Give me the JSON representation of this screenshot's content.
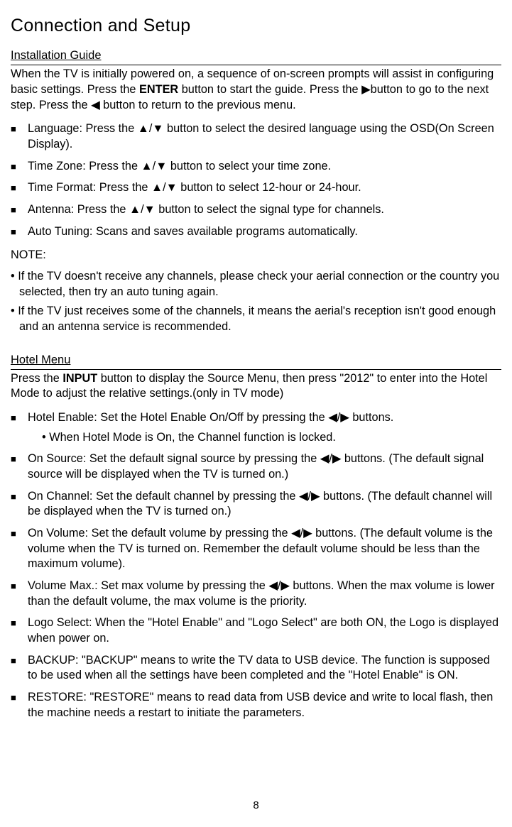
{
  "page": {
    "title": "Connection and Setup",
    "pageNumber": "8"
  },
  "section1": {
    "heading": "Installation Guide",
    "intro_p1": "When the TV is initially powered on, a sequence of on-screen prompts will assist in configuring basic settings. Press the ",
    "intro_enter": "ENTER",
    "intro_p2": " button to start the guide. Press the ▶button to go to the next step. Press the ◀ button to return to the previous menu.",
    "items": {
      "language": "Language: Press the ▲/▼ button to select the desired language using the OSD(On Screen Display).",
      "timezone": "Time Zone: Press the ▲/▼ button to select your time zone.",
      "timeformat": "Time Format: Press the ▲/▼ button to select 12-hour or 24-hour.",
      "antenna": "Antenna: Press the ▲/▼ button to select the signal type for channels.",
      "autotuning": "Auto Tuning: Scans and saves available programs automatically."
    },
    "noteLabel": "NOTE:",
    "note1": "• If the TV doesn't receive any channels, please check your aerial connection or the country you selected, then try an auto tuning again.",
    "note2": "• If the TV just receives some of the channels, it means the aerial's reception isn't good enough and an antenna service is recommended."
  },
  "section2": {
    "heading": "Hotel Menu",
    "intro_p1": "Press the ",
    "intro_input": " INPUT ",
    "intro_p2": " button to display the Source Menu, then press \"2012\" to enter into the Hotel Mode to adjust the relative settings.(only in TV mode)",
    "items": {
      "hotelEnable": "Hotel Enable: Set the Hotel Enable On/Off by pressing the ◀/▶  buttons.",
      "hotelEnableSub": "• When Hotel Mode is On, the Channel function is locked.",
      "onSource": "On Source: Set the default signal source by pressing the ◀/▶ buttons. (The default signal source will be displayed when the TV is turned on.)",
      "onChannel": "On Channel: Set the default channel by pressing the  ◀/▶  buttons. (The default channel will be displayed when the TV is turned on.)",
      "onVolume": "On Volume: Set the default volume by pressing the ◀/▶  buttons. (The default volume is the volume when the TV is turned on. Remember the default volume should be less than the maximum volume).",
      "volumeMax": "Volume Max.: Set max volume by pressing the ◀/▶  buttons. When the max volume is lower than the default volume, the max volume is the priority.",
      "logoSelect": "Logo Select: When the \"Hotel Enable\" and \"Logo Select\" are both ON, the Logo is displayed when power on.",
      "backup": "BACKUP: \"BACKUP\" means to write the TV data to USB device. The function is supposed to be used when all the settings have been completed and the \"Hotel Enable\" is ON.",
      "restore": "RESTORE: \"RESTORE\" means to read data from USB device and write to local flash, then the machine needs a restart to initiate the parameters."
    }
  }
}
